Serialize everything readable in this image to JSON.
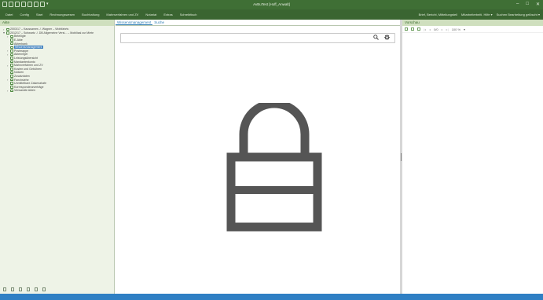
{
  "window": {
    "title": "AvBuTest [Hoff_Anwalt]",
    "controls": {
      "minimize": "–",
      "maximize": "□",
      "close": "✕"
    }
  },
  "quick_access": {
    "icons": [
      "save-icon",
      "new-icon",
      "print-icon",
      "copy-icon",
      "open-icon",
      "undo-icon",
      "window-icon"
    ],
    "dropdown": "▾"
  },
  "menu": {
    "items": [
      "Datei",
      "Config",
      "Start",
      "Rechnungswesen",
      "Buchhaltung",
      "Mahnverfahren und ZV",
      "Notariat",
      "Extras",
      "Schreibtisch"
    ],
    "right_items": [
      "Brief, Bericht, Mitteilungsteil",
      "Mitarbeiterbeiti. Hilfe ▾",
      "Suchen Bearbeitung gelöscht ▾"
    ]
  },
  "left_pane": {
    "header": "Akte",
    "tree": [
      {
        "depth": 0,
        "toggle": "›",
        "label": "2003/17 – Kaussames ./. Wagner – Wohlfahrts",
        "selected": false
      },
      {
        "depth": 0,
        "toggle": "▾",
        "label": "2012/17 – Schwartz ./. DB Allgemeine Versi... – Mobilisal zur Miete",
        "selected": false
      },
      {
        "depth": 1,
        "toggle": "›",
        "label": "Beteiligte",
        "selected": false
      },
      {
        "depth": 1,
        "toggle": "",
        "label": "E-Akte",
        "selected": false
      },
      {
        "depth": 1,
        "toggle": "",
        "label": "Aktenbank",
        "selected": false
      },
      {
        "depth": 1,
        "toggle": "",
        "label": "Wissensmanagement",
        "selected": true
      },
      {
        "depth": 1,
        "toggle": "›",
        "label": "Postmappe",
        "selected": false
      },
      {
        "depth": 1,
        "toggle": "›",
        "label": "Aktenregel",
        "selected": false
      },
      {
        "depth": 1,
        "toggle": "",
        "label": "Leistungsübersicht",
        "selected": false
      },
      {
        "depth": 1,
        "toggle": "",
        "label": "Mandantenkonto",
        "selected": false
      },
      {
        "depth": 1,
        "toggle": "›",
        "label": "Mahnverfahren und ZV",
        "selected": false
      },
      {
        "depth": 1,
        "toggle": "",
        "label": "Kosten und Gebühren",
        "selected": false
      },
      {
        "depth": 1,
        "toggle": "",
        "label": "Notizen",
        "selected": false
      },
      {
        "depth": 1,
        "toggle": "",
        "label": "Zusatzdaten",
        "selected": false
      },
      {
        "depth": 1,
        "toggle": "›",
        "label": "Fanchsiehe",
        "selected": false
      },
      {
        "depth": 1,
        "toggle": "",
        "label": "Unmittelbare Zaisenahafe",
        "selected": false
      },
      {
        "depth": 1,
        "toggle": "",
        "label": "Korrespondenzverträge",
        "selected": false
      },
      {
        "depth": 1,
        "toggle": "›",
        "label": "Verwandte Akten",
        "selected": false
      }
    ],
    "footer_icons": [
      "folder-icon",
      "person-icon",
      "document-icon",
      "document-icon",
      "chart-icon",
      "trash-icon"
    ]
  },
  "center_pane": {
    "tabs": [
      {
        "label": "Wissensmanagement",
        "active": true
      },
      {
        "label": "Suche",
        "active": false
      }
    ],
    "search": {
      "value": "",
      "placeholder": ""
    },
    "lock_visible": true
  },
  "right_pane": {
    "header": "Vorschau",
    "toolbar": {
      "page": "0/0",
      "zoom": "100 %",
      "zoom_caret": "▾"
    }
  },
  "colors": {
    "title_bar": "#3f6f35",
    "menu_bar": "#3a6531",
    "left_pane_bg": "#eef3e7",
    "pane_header_bg": "#cfdfbe",
    "status_bar": "#2f7fc4",
    "lock_icon": "#555555",
    "tab_text": "#2e7db4",
    "selection": "#3d7fbf"
  }
}
